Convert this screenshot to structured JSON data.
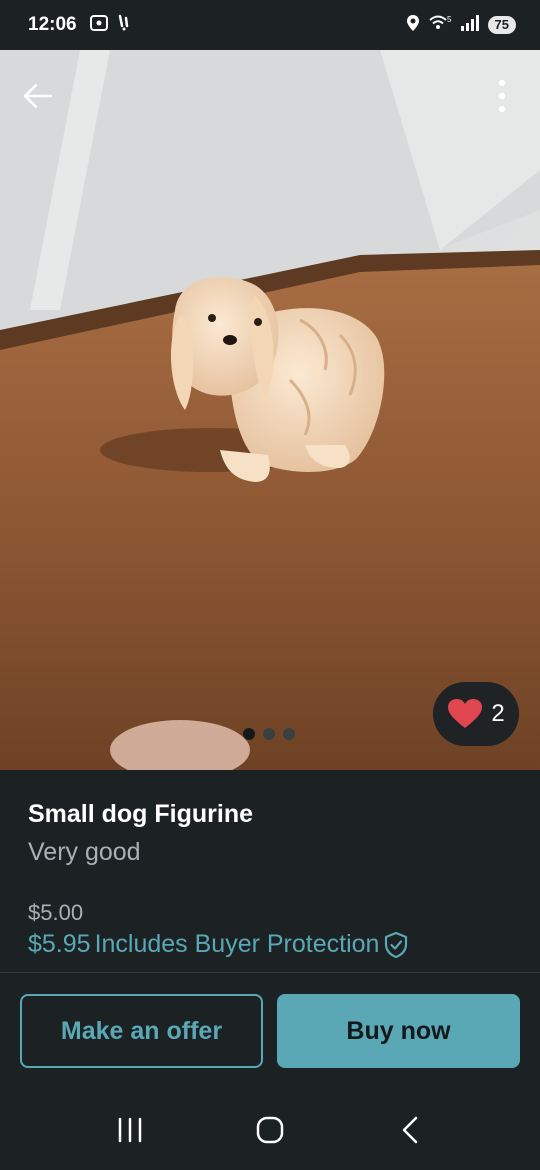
{
  "status_bar": {
    "time": "12:06",
    "battery": "75",
    "icons": [
      "screenshot-icon",
      "notification-icon",
      "location-icon",
      "wifi-icon",
      "signal-icon",
      "battery-icon"
    ]
  },
  "gallery": {
    "like_count": "2",
    "page_count": 3,
    "active_page": 1
  },
  "item": {
    "title": "Small dog Figurine",
    "condition": "Very good",
    "price": "$5.00",
    "price_total": "$5.95",
    "buyer_protection_label": "Includes Buyer Protection"
  },
  "actions": {
    "offer_label": "Make an offer",
    "buy_label": "Buy now"
  },
  "colors": {
    "accent": "#5aa8b5",
    "background": "#1c2124",
    "heart": "#e0464f"
  }
}
